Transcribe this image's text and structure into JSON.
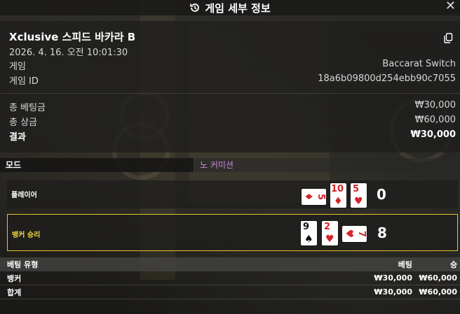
{
  "header": {
    "title": "게임 세부 정보",
    "history_icon": "history-icon",
    "close_icon": "close-icon"
  },
  "game": {
    "title": "Xclusive 스피드 바카라 B",
    "datetime": "2026. 4. 16. 오전 10:01:30",
    "fields": [
      {
        "label": "게임",
        "value": "Baccarat Switch"
      },
      {
        "label": "게임 ID",
        "value": "18a6b09800d254ebb90c7055"
      }
    ],
    "totals": [
      {
        "label": "총 베팅금",
        "value": "₩30,000"
      },
      {
        "label": "총 상금",
        "value": "₩60,000"
      },
      {
        "label": "결과",
        "value": "₩30,000"
      }
    ]
  },
  "mode": {
    "label": "모드",
    "value": "노 커미션"
  },
  "hands": {
    "player": {
      "label": "플레이어",
      "score": "0",
      "cards": [
        {
          "rank": "5",
          "suit": "♦"
        },
        {
          "rank": "10",
          "suit": "♦"
        },
        {
          "rank": "5",
          "suit": "♥"
        }
      ]
    },
    "banker": {
      "label": "뱅커 승리",
      "score": "8",
      "cards": [
        {
          "rank": "9",
          "suit": "♠"
        },
        {
          "rank": "2",
          "suit": "♥"
        },
        {
          "rank": "7",
          "suit": "♥"
        }
      ]
    }
  },
  "bets": {
    "headers": [
      "베팅 유형",
      "베팅",
      "승"
    ],
    "rows": [
      [
        "뱅커",
        "₩30,000",
        "₩60,000"
      ],
      [
        "합계",
        "₩30,000",
        "₩60,000"
      ]
    ]
  },
  "colors": {
    "accent_purple": "#c98be9",
    "winner_border": "#e5c627",
    "card_red": "#d6222a"
  }
}
